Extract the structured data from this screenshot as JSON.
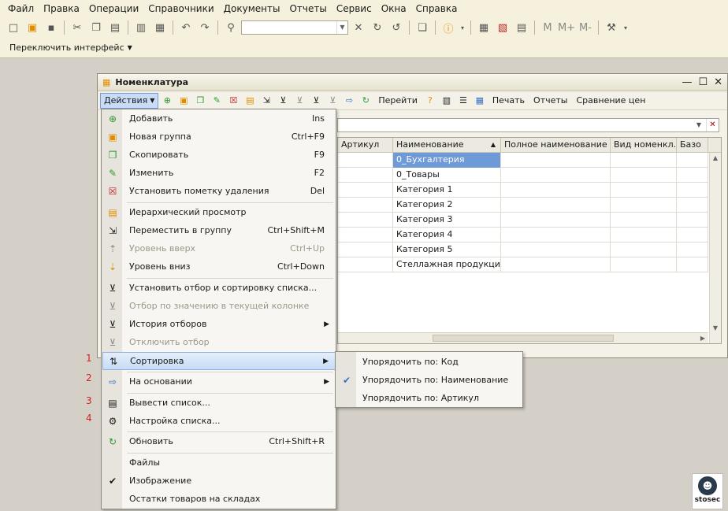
{
  "menubar": {
    "items": [
      "Файл",
      "Правка",
      "Операции",
      "Справочники",
      "Документы",
      "Отчеты",
      "Сервис",
      "Окна",
      "Справка"
    ]
  },
  "toolbar2": {
    "switch_interface": "Переключить интерфейс"
  },
  "toolbar1": {
    "memory_buttons": [
      "M",
      "M+",
      "M-"
    ]
  },
  "window": {
    "title": "Номенклатура",
    "toolbar": {
      "actions": "Действия",
      "goto": "Перейти",
      "print": "Печать",
      "reports": "Отчеты",
      "compare_prices": "Сравнение цен"
    }
  },
  "grid": {
    "columns": [
      "Артикул",
      "Наименование",
      "Полное наименование",
      "Вид номенкл...",
      "Базо"
    ],
    "rows": [
      [
        "",
        "0_Бухгалтерия",
        "",
        "",
        ""
      ],
      [
        "",
        "0_Товары",
        "",
        "",
        ""
      ],
      [
        "",
        "Категория 1",
        "",
        "",
        ""
      ],
      [
        "",
        "Категория 2",
        "",
        "",
        ""
      ],
      [
        "",
        "Категория 3",
        "",
        "",
        ""
      ],
      [
        "",
        "Категория 4",
        "",
        "",
        ""
      ],
      [
        "",
        "Категория 5",
        "",
        "",
        ""
      ],
      [
        "",
        "Стеллажная продукция",
        "",
        "",
        ""
      ]
    ],
    "selected_row": 0
  },
  "popup_menu": {
    "items": [
      {
        "label": "Добавить",
        "key": "Ins"
      },
      {
        "label": "Новая группа",
        "key": "Ctrl+F9"
      },
      {
        "label": "Скопировать",
        "key": "F9"
      },
      {
        "label": "Изменить",
        "key": "F2"
      },
      {
        "label": "Установить пометку удаления",
        "key": "Del"
      },
      {
        "label": "Иерархический просмотр",
        "key": ""
      },
      {
        "label": "Переместить в группу",
        "key": "Ctrl+Shift+M"
      },
      {
        "label": "Уровень вверх",
        "key": "Ctrl+Up"
      },
      {
        "label": "Уровень вниз",
        "key": "Ctrl+Down"
      },
      {
        "label": "Установить отбор и сортировку списка...",
        "key": ""
      },
      {
        "label": "Отбор по значению в текущей колонке",
        "key": ""
      },
      {
        "label": "История отборов",
        "key": ""
      },
      {
        "label": "Отключить отбор",
        "key": ""
      },
      {
        "label": "Сортировка",
        "key": ""
      },
      {
        "label": "На основании",
        "key": ""
      },
      {
        "label": "Вывести список...",
        "key": ""
      },
      {
        "label": "Настройка списка...",
        "key": ""
      },
      {
        "label": "Обновить",
        "key": "Ctrl+Shift+R"
      },
      {
        "label": "Файлы",
        "key": ""
      },
      {
        "label": "Изображение",
        "key": ""
      },
      {
        "label": "Остатки товаров на складах",
        "key": ""
      }
    ]
  },
  "submenu": {
    "items": [
      {
        "label": "Упорядочить по:  Код"
      },
      {
        "label": "Упорядочить по:  Наименование"
      },
      {
        "label": "Упорядочить по:  Артикул"
      }
    ]
  },
  "annotations": [
    "1",
    "2",
    "3",
    "4"
  ],
  "logo": {
    "text": "stosec"
  }
}
